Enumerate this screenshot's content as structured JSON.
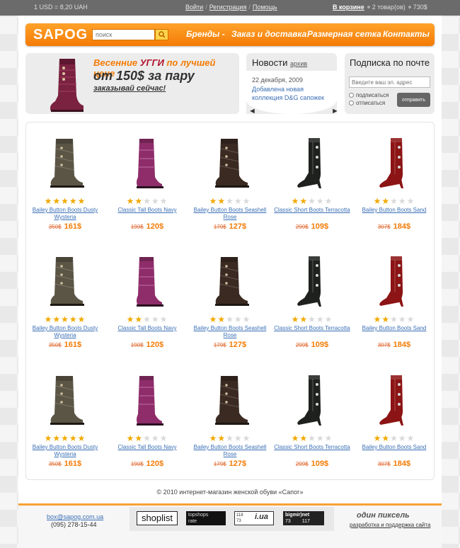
{
  "topbar": {
    "rate": "1 USD = 8,20 UAH",
    "login": "Войти",
    "register": "Регистрация",
    "help": "Помощь",
    "cart_link": "В корзине",
    "cart_items": "2 товар(ов)",
    "cart_total": "730$"
  },
  "header": {
    "logo": "SAPOG",
    "search_placeholder": "поиск",
    "menu": [
      "Бренды -",
      "Заказ и доставка",
      "Размерная сетка",
      "Контакты"
    ]
  },
  "promo": {
    "line1_a": "Весенние ",
    "line1_b": "УГГИ",
    "line1_c": " по лучшей цене",
    "line2": "от 150$ за пару",
    "line3": "заказывай сейчас!"
  },
  "news": {
    "title": "Новости",
    "archive": "архив",
    "date": "22 декабря, 2009",
    "item": "Добавлена новая коллекция D&G сапожек"
  },
  "subscribe": {
    "title": "Подписка по почте",
    "placeholder": "Введите ваш эл. адрес",
    "opt_sub": "подписаться",
    "opt_unsub": "отписаться",
    "button": "отправить"
  },
  "products": [
    {
      "name": "Bailey Button Boots Dusty Wysteria",
      "old": "350$",
      "price": "161$",
      "rating": 5,
      "color": "#5a5545",
      "style": "wrap"
    },
    {
      "name": "Classic Tall Boots Navy",
      "old": "190$",
      "price": "120$",
      "rating": 2,
      "color": "#8e2d6a",
      "style": "tall"
    },
    {
      "name": "Bailey Button Boots Seashell Rose",
      "old": "179$",
      "price": "127$",
      "rating": 2,
      "color": "#3a2a22",
      "style": "wrap"
    },
    {
      "name": "Classic Short Boots Terracotta",
      "old": "299$",
      "price": "109$",
      "rating": 2,
      "color": "#1f211e",
      "style": "heel"
    },
    {
      "name": "Bailey Button Boots Sand",
      "old": "307$",
      "price": "184$",
      "rating": 2,
      "color": "#8c1414",
      "style": "heel"
    }
  ],
  "footer": {
    "copyright": "© 2010 интернет-магазин женской обуви «Сапог»",
    "email": "box@sapog.com.ua",
    "phone": "(095) 278-15-44",
    "badge_shoplist": "shoplist",
    "badge_topshops": "topshops",
    "badge_rate": "rate",
    "badge_iua": "i.ua",
    "badge_bigmir": "bigmir)net",
    "badge_bigmir_n1": "73",
    "badge_bigmir_n2": "117",
    "badge_iua_n1": "118",
    "badge_iua_n2": "73",
    "dev_name": "один пиксель",
    "dev_link": "разработка и поддержка сайта"
  }
}
